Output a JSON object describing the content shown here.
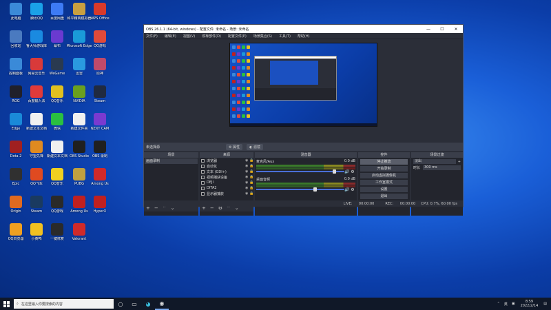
{
  "desktop": {
    "icons": [
      {
        "label": "此电脑",
        "color": "#3b8ad8"
      },
      {
        "label": "腾讯QQ",
        "color": "#1aa1e8"
      },
      {
        "label": "百度网盘",
        "color": "#3d7bf5"
      },
      {
        "label": "和平精英模拟器",
        "color": "#c8a040"
      },
      {
        "label": "WPS Office",
        "color": "#d83a2a"
      },
      {
        "label": "回收站",
        "color": "#4a7ac0"
      },
      {
        "label": "鲁大师游戏库",
        "color": "#1a8ae0"
      },
      {
        "label": "幕布",
        "color": "#6a3ad0"
      },
      {
        "label": "Microsoft Edge",
        "color": "#1a9ad8"
      },
      {
        "label": "QQ游戏",
        "color": "#e04a3a"
      },
      {
        "label": "控制面板",
        "color": "#3a8ad8"
      },
      {
        "label": "网易云音乐",
        "color": "#d83a3a"
      },
      {
        "label": "WeGame",
        "color": "#2a3a50"
      },
      {
        "label": "迅雷",
        "color": "#2a9ae0"
      },
      {
        "label": "原神",
        "color": "#c04a6a"
      },
      {
        "label": "ROG",
        "color": "#20202a"
      },
      {
        "label": "百度输入法",
        "color": "#e03a3a"
      },
      {
        "label": "QQ音乐",
        "color": "#e0c020"
      },
      {
        "label": "NVIDIA",
        "color": "#6aa020"
      },
      {
        "label": "Steam",
        "color": "#202a40"
      },
      {
        "label": "Edge",
        "color": "#1a8ad8"
      },
      {
        "label": "新建文本文档",
        "color": "#f0f0f0"
      },
      {
        "label": "微信",
        "color": "#2ac040"
      },
      {
        "label": "新建文件夹",
        "color": "#f0f0f0"
      },
      {
        "label": "NZXT CAM",
        "color": "#7a3ad0"
      },
      {
        "label": "Dota 2",
        "color": "#a02020"
      },
      {
        "label": "守望先锋",
        "color": "#e08a20"
      },
      {
        "label": "新建文本文档",
        "color": "#f0f0f0"
      },
      {
        "label": "OBS Studio",
        "color": "#202020"
      },
      {
        "label": "OBS 录制",
        "color": "#202020"
      },
      {
        "label": "Epic",
        "color": "#303030"
      },
      {
        "label": "QQ飞车",
        "color": "#e04a20"
      },
      {
        "label": "QQ音乐",
        "color": "#f0d020"
      },
      {
        "label": "PUBG",
        "color": "#c0a040"
      },
      {
        "label": "Among Us",
        "color": "#d02a2a"
      },
      {
        "label": "Origin",
        "color": "#e06a20"
      },
      {
        "label": "Steam",
        "color": "#1a3a60"
      },
      {
        "label": "QQ游戏",
        "color": "#2a2a2a"
      },
      {
        "label": "Among Us",
        "color": "#c02020"
      },
      {
        "label": "HyperX",
        "color": "#c02020"
      },
      {
        "label": "QQ浏览器",
        "color": "#f0a020"
      },
      {
        "label": "小黄鸭",
        "color": "#f0c020"
      },
      {
        "label": "一键修复",
        "color": "#2a2a2a"
      },
      {
        "label": "Valorant",
        "color": "#d02a2a"
      }
    ]
  },
  "obs": {
    "title": "OBS 26.1.1 (64-bit, windows) - 配置文件: 未命名 - 场景: 未命名",
    "window_buttons": [
      "—",
      "☐",
      "✕"
    ],
    "menu": [
      "文件(F)",
      "编辑(E)",
      "视图(V)",
      "停靠部件(D)",
      "配置文件(P)",
      "场景集合(S)",
      "工具(T)",
      "帮助(H)"
    ],
    "controls_bar": {
      "source_label": "未选择源",
      "properties_label": "属性",
      "filters_label": "滤镜"
    },
    "scenes": {
      "header": "场景",
      "items": [
        "画面录制"
      ]
    },
    "sources": {
      "header": "来源",
      "items": [
        "浏览器",
        "自动化",
        "文本 (GDI+)",
        "视频捕获设备",
        "DEJI",
        "DITA2",
        "显示器捕获"
      ]
    },
    "mixer": {
      "header": "混音器",
      "channels": [
        {
          "name": "麦克风/Aux",
          "db": "0.0 dB"
        },
        {
          "name": "桌面音频",
          "db": "0.0 dB"
        }
      ]
    },
    "transitions": {
      "header": "场景过渡",
      "type": "淡出",
      "duration_label": "时长",
      "duration": "300 ms"
    },
    "controls": {
      "header": "控件",
      "buttons": [
        "停止推流",
        "开始录制",
        "启动虚拟摄像机",
        "工作室模式",
        "设置",
        "退出"
      ]
    },
    "status": {
      "live_label": "LIVE:",
      "live_time": "00:00:00",
      "rec_label": "REC:",
      "rec_time": "00:00:00",
      "cpu": "CPU: 0.7%, 60.00 fps"
    }
  },
  "taskbar": {
    "search_placeholder": "在这里输入你要搜索的内容",
    "time": "8:59",
    "date": "2022/2/14",
    "ime": "英"
  }
}
